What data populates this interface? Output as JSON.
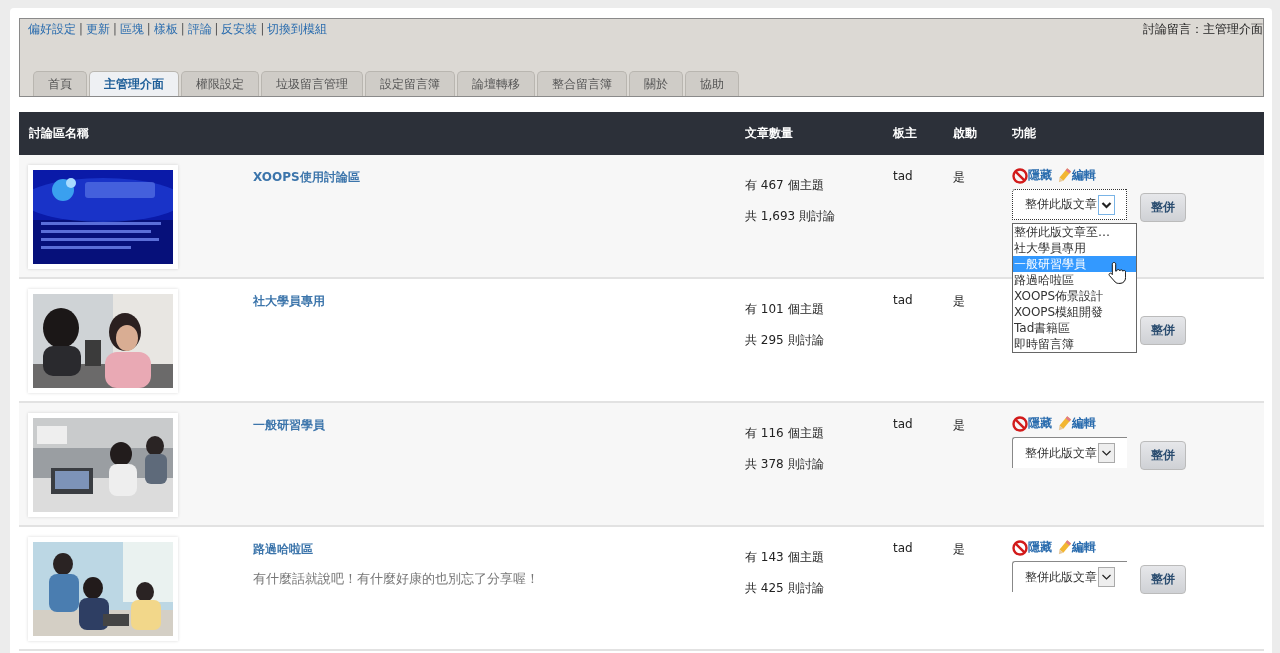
{
  "top_links": [
    "偏好設定",
    "更新",
    "區塊",
    "樣板",
    "評論",
    "反安裝",
    "切換到模組"
  ],
  "link_separator": "|",
  "page_title": "討論留言：主管理介面",
  "tabs": [
    {
      "label": "首頁",
      "selected": false
    },
    {
      "label": "主管理介面",
      "selected": true
    },
    {
      "label": "權限設定",
      "selected": false
    },
    {
      "label": "垃圾留言管理",
      "selected": false
    },
    {
      "label": "設定留言簿",
      "selected": false
    },
    {
      "label": "論壇轉移",
      "selected": false
    },
    {
      "label": "整合留言簿",
      "selected": false
    },
    {
      "label": "關於",
      "selected": false
    },
    {
      "label": "協助",
      "selected": false
    }
  ],
  "table": {
    "columns": [
      "討論區名稱",
      "文章數量",
      "板主",
      "啟動",
      "功能"
    ],
    "rows": [
      {
        "name": "XOOPS使用討論區",
        "topics": "有 467 個主題",
        "posts": "共 1,693 則討論",
        "owner": "tad",
        "active": "是",
        "actions": {
          "hide": "隱藏",
          "edit": "編輯"
        },
        "merge_select": {
          "value": "整併此版文章",
          "focused": true,
          "open": true,
          "options": [
            {
              "label": "整併此版文章至…",
              "selected": false
            },
            {
              "label": "社大學員專用",
              "selected": false
            },
            {
              "label": "一般研習學員",
              "selected": true
            },
            {
              "label": "路過哈啦區",
              "selected": false
            },
            {
              "label": "XOOPS佈景設計",
              "selected": false
            },
            {
              "label": "XOOPS模組開發",
              "selected": false
            },
            {
              "label": "Tad書籍區",
              "selected": false
            },
            {
              "label": "即時留言簿",
              "selected": false
            }
          ]
        },
        "merge_button": "整併"
      },
      {
        "name": "社大學員專用",
        "topics": "有 101 個主題",
        "posts": "共 295 則討論",
        "owner": "tad",
        "active": "是",
        "merge_button": "整併"
      },
      {
        "name": "一般研習學員",
        "topics": "有 116 個主題",
        "posts": "共 378 則討論",
        "owner": "tad",
        "active": "是",
        "actions": {
          "hide": "隱藏",
          "edit": "編輯"
        },
        "merge_select": {
          "value": "整併此版文章",
          "focused": false
        },
        "merge_button": "整併"
      },
      {
        "name": "路過哈啦區",
        "description": "有什麼話就說吧！有什麼好康的也別忘了分享喔！",
        "topics": "有 143 個主題",
        "posts": "共 425 則討論",
        "owner": "tad",
        "active": "是",
        "actions": {
          "hide": "隱藏",
          "edit": "編輯"
        },
        "merge_select": {
          "value": "整併此版文章",
          "focused": false
        },
        "merge_button": "整併"
      }
    ]
  }
}
